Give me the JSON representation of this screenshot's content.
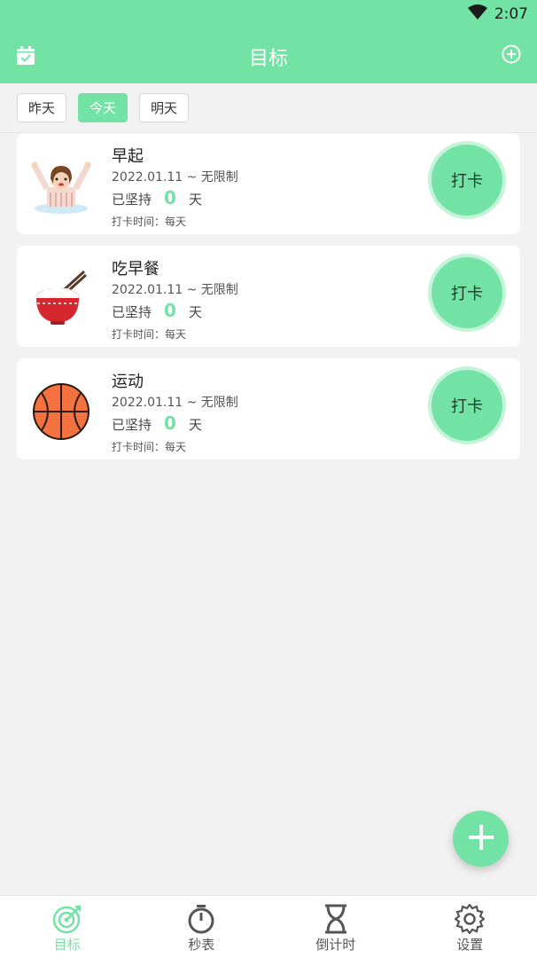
{
  "status": {
    "time": "2:07"
  },
  "header": {
    "title": "目标",
    "left_icon": "calendar-check-icon",
    "right_icon": "plus-circle-icon"
  },
  "days": [
    {
      "label": "昨天",
      "active": false
    },
    {
      "label": "今天",
      "active": true
    },
    {
      "label": "明天",
      "active": false
    }
  ],
  "goals": [
    {
      "name": "早起",
      "range": "2022.01.11 ~ 无限制",
      "persist_prefix": "已坚持",
      "count": "0",
      "persist_suffix": "天",
      "schedule": "打卡时间：每天",
      "button": "打卡",
      "icon": "girl-waking-up-icon"
    },
    {
      "name": "吃早餐",
      "range": "2022.01.11 ~ 无限制",
      "persist_prefix": "已坚持",
      "count": "0",
      "persist_suffix": "天",
      "schedule": "打卡时间：每天",
      "button": "打卡",
      "icon": "rice-bowl-icon"
    },
    {
      "name": "运动",
      "range": "2022.01.11 ~ 无限制",
      "persist_prefix": "已坚持",
      "count": "0",
      "persist_suffix": "天",
      "schedule": "打卡时间：每天",
      "button": "打卡",
      "icon": "basketball-icon"
    }
  ],
  "fab": {
    "icon": "plus-icon"
  },
  "nav": [
    {
      "label": "目标",
      "icon": "target-icon",
      "active": true
    },
    {
      "label": "秒表",
      "icon": "stopwatch-icon",
      "active": false
    },
    {
      "label": "倒计时",
      "icon": "hourglass-icon",
      "active": false
    },
    {
      "label": "设置",
      "icon": "gear-icon",
      "active": false
    }
  ],
  "colors": {
    "accent": "#72e3a4",
    "background": "#f2f2f2"
  }
}
